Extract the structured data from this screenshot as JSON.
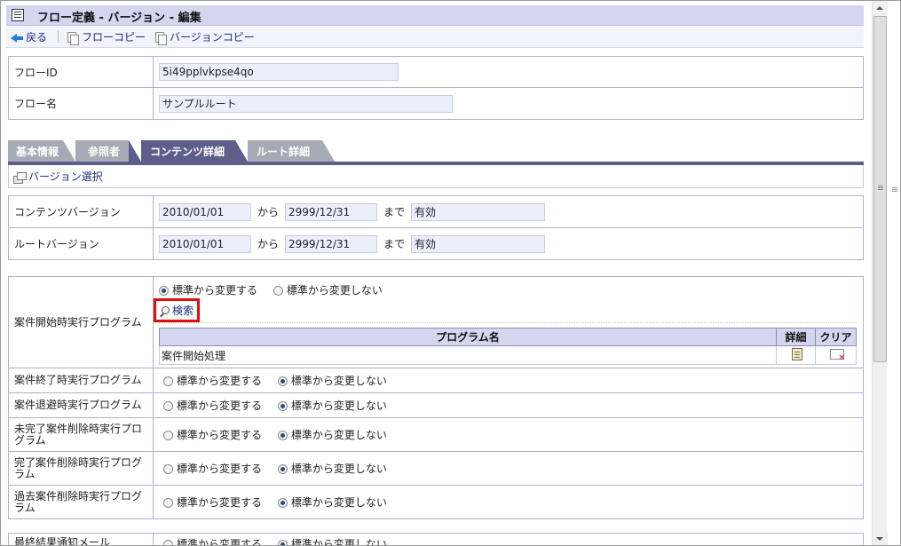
{
  "title": "フロー定義 - バージョン - 編集",
  "toolbar": {
    "back": "戻る",
    "flow_copy": "フローコピー",
    "version_copy": "バージョンコピー"
  },
  "flow": {
    "id_label": "フローID",
    "id_value": "5i49pplvkpse4qo",
    "name_label": "フロー名",
    "name_value": "サンプルルート"
  },
  "tabs": [
    "基本情報",
    "参照者",
    "コンテンツ詳細",
    "ルート詳細"
  ],
  "active_tab": "コンテンツ詳細",
  "version_select": "バージョン選択",
  "versions": {
    "from_word": "から",
    "to_word": "まで",
    "content": {
      "label": "コンテンツバージョン",
      "start": "2010/01/01",
      "end": "2999/12/31",
      "status": "有効"
    },
    "route": {
      "label": "ルートバージョン",
      "start": "2010/01/01",
      "end": "2999/12/31",
      "status": "有効"
    }
  },
  "radio_change": "標準から変更する",
  "radio_nochange": "標準から変更しない",
  "search": "検索",
  "program_table": {
    "col_name": "プログラム名",
    "col_detail": "詳細",
    "col_clear": "クリア",
    "row_name": "案件開始処理"
  },
  "programs": {
    "p0": "案件開始時実行プログラム",
    "p1": "案件終了時実行プログラム",
    "p2": "案件退避時実行プログラム",
    "p3": "未完了案件削除時実行プログラム",
    "p4": "完了案件削除時実行プログラム",
    "p5": "過去案件削除時実行プログラム",
    "p6": "最終結果通知メール"
  },
  "colors": {
    "header_bg": "#d3d6ee",
    "tab_active": "#5b5f8a",
    "tab_inactive": "#a7a9b5",
    "highlight": "#e01010",
    "link": "#1b2f8a"
  }
}
